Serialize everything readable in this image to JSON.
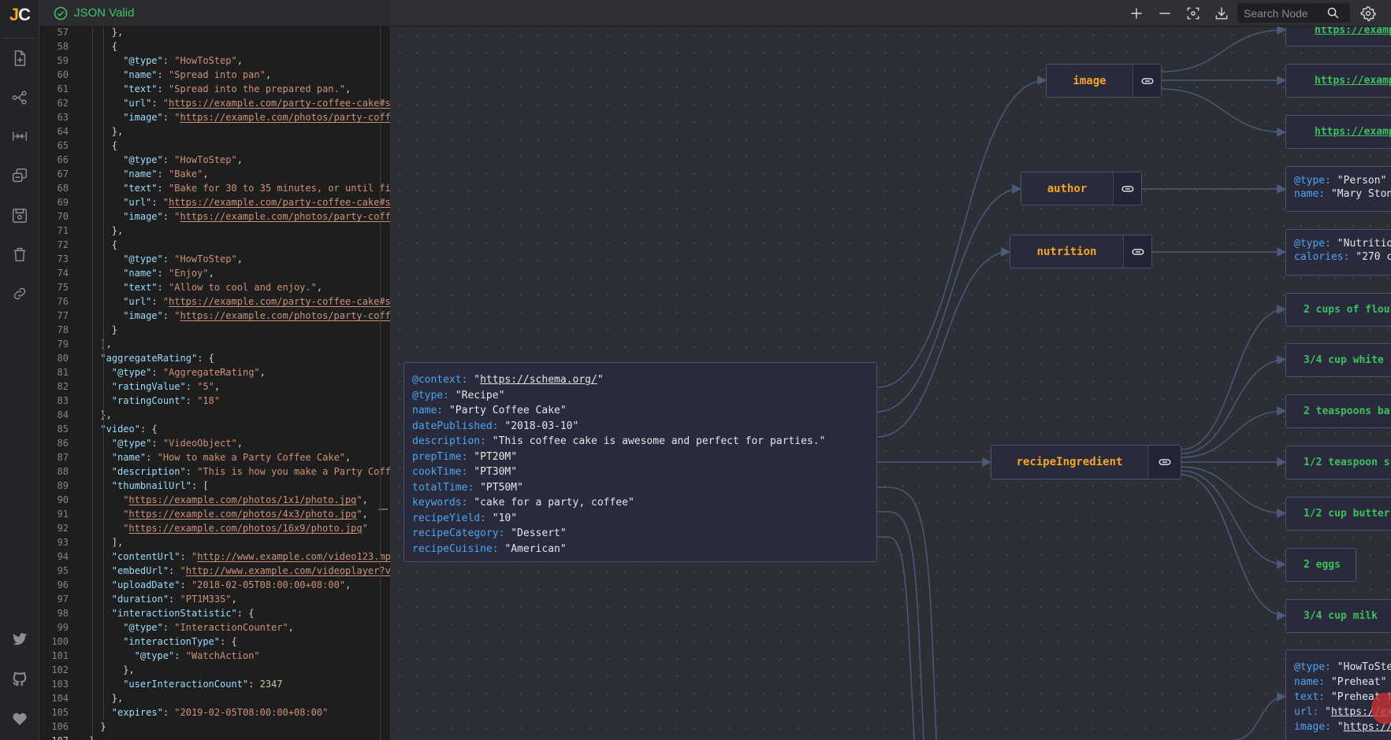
{
  "app": {
    "logo": "JC",
    "status": "JSON Valid"
  },
  "sidebar": {
    "top_icons": [
      "new-file-icon",
      "graph-icon",
      "collapse-icon",
      "duplicate-icon",
      "save-icon",
      "trash-icon",
      "link-icon"
    ],
    "bottom_icons": [
      "twitter-icon",
      "github-icon",
      "heart-icon"
    ]
  },
  "toolbar": {
    "search_placeholder": "Search Node",
    "buttons": [
      "zoom-in-icon",
      "zoom-out-icon",
      "fit-view-icon",
      "download-icon"
    ]
  },
  "editor": {
    "current_line": 107,
    "lines": [
      {
        "n": 57,
        "i": 2,
        "t": "},"
      },
      {
        "n": 58,
        "i": 2,
        "t": "{"
      },
      {
        "n": 59,
        "i": 3,
        "k": "@type",
        "v": "HowToStep",
        "vt": "s",
        "e": ","
      },
      {
        "n": 60,
        "i": 3,
        "k": "name",
        "v": "Spread into pan",
        "vt": "s",
        "e": ","
      },
      {
        "n": 61,
        "i": 3,
        "k": "text",
        "v": "Spread into the prepared pan.",
        "vt": "s",
        "e": ","
      },
      {
        "n": 62,
        "i": 3,
        "k": "url",
        "v": "https://example.com/party-coffee-cake#s",
        "vt": "u",
        "open": true
      },
      {
        "n": 63,
        "i": 3,
        "k": "image",
        "v": "https://example.com/photos/party-coff",
        "vt": "u",
        "open": true
      },
      {
        "n": 64,
        "i": 2,
        "t": "},"
      },
      {
        "n": 65,
        "i": 2,
        "t": "{"
      },
      {
        "n": 66,
        "i": 3,
        "k": "@type",
        "v": "HowToStep",
        "vt": "s",
        "e": ","
      },
      {
        "n": 67,
        "i": 3,
        "k": "name",
        "v": "Bake",
        "vt": "s",
        "e": ","
      },
      {
        "n": 68,
        "i": 3,
        "k": "text",
        "v": "Bake for 30 to 35 minutes, or until fi",
        "vt": "s",
        "open": true
      },
      {
        "n": 69,
        "i": 3,
        "k": "url",
        "v": "https://example.com/party-coffee-cake#s",
        "vt": "u",
        "open": true
      },
      {
        "n": 70,
        "i": 3,
        "k": "image",
        "v": "https://example.com/photos/party-coff",
        "vt": "u",
        "open": true
      },
      {
        "n": 71,
        "i": 2,
        "t": "},"
      },
      {
        "n": 72,
        "i": 2,
        "t": "{"
      },
      {
        "n": 73,
        "i": 3,
        "k": "@type",
        "v": "HowToStep",
        "vt": "s",
        "e": ","
      },
      {
        "n": 74,
        "i": 3,
        "k": "name",
        "v": "Enjoy",
        "vt": "s",
        "e": ","
      },
      {
        "n": 75,
        "i": 3,
        "k": "text",
        "v": "Allow to cool and enjoy.",
        "vt": "s",
        "e": ","
      },
      {
        "n": 76,
        "i": 3,
        "k": "url",
        "v": "https://example.com/party-coffee-cake#s",
        "vt": "u",
        "open": true
      },
      {
        "n": 77,
        "i": 3,
        "k": "image",
        "v": "https://example.com/photos/party-coff",
        "vt": "u",
        "open": true
      },
      {
        "n": 78,
        "i": 2,
        "t": "}"
      },
      {
        "n": 79,
        "i": 1,
        "t": "],"
      },
      {
        "n": 80,
        "i": 1,
        "k": "aggregateRating",
        "t": "{"
      },
      {
        "n": 81,
        "i": 2,
        "k": "@type",
        "v": "AggregateRating",
        "vt": "s",
        "e": ","
      },
      {
        "n": 82,
        "i": 2,
        "k": "ratingValue",
        "v": "5",
        "vt": "s",
        "e": ","
      },
      {
        "n": 83,
        "i": 2,
        "k": "ratingCount",
        "v": "18",
        "vt": "s"
      },
      {
        "n": 84,
        "i": 1,
        "t": "},"
      },
      {
        "n": 85,
        "i": 1,
        "k": "video",
        "t": "{"
      },
      {
        "n": 86,
        "i": 2,
        "k": "@type",
        "v": "VideoObject",
        "vt": "s",
        "e": ","
      },
      {
        "n": 87,
        "i": 2,
        "k": "name",
        "v": "How to make a Party Coffee Cake",
        "vt": "s",
        "e": ","
      },
      {
        "n": 88,
        "i": 2,
        "k": "description",
        "v": "This is how you make a Party Coff",
        "vt": "s",
        "open": true
      },
      {
        "n": 89,
        "i": 2,
        "k": "thumbnailUrl",
        "t": "["
      },
      {
        "n": 90,
        "i": 3,
        "v": "https://example.com/photos/1x1/photo.jpg",
        "vt": "u",
        "e": ","
      },
      {
        "n": 91,
        "i": 3,
        "v": "https://example.com/photos/4x3/photo.jpg",
        "vt": "u",
        "e": ","
      },
      {
        "n": 92,
        "i": 3,
        "v": "https://example.com/photos/16x9/photo.jpg",
        "vt": "u"
      },
      {
        "n": 93,
        "i": 2,
        "t": "],"
      },
      {
        "n": 94,
        "i": 2,
        "k": "contentUrl",
        "v": "http://www.example.com/video123.mp",
        "vt": "u",
        "open": true
      },
      {
        "n": 95,
        "i": 2,
        "k": "embedUrl",
        "v": "http://www.example.com/videoplayer?v",
        "vt": "u",
        "open": true
      },
      {
        "n": 96,
        "i": 2,
        "k": "uploadDate",
        "v": "2018-02-05T08:00:00+08:00",
        "vt": "s",
        "e": ","
      },
      {
        "n": 97,
        "i": 2,
        "k": "duration",
        "v": "PT1M33S",
        "vt": "s",
        "e": ","
      },
      {
        "n": 98,
        "i": 2,
        "k": "interactionStatistic",
        "t": "{"
      },
      {
        "n": 99,
        "i": 3,
        "k": "@type",
        "v": "InteractionCounter",
        "vt": "s",
        "e": ","
      },
      {
        "n": 100,
        "i": 3,
        "k": "interactionType",
        "t": "{"
      },
      {
        "n": 101,
        "i": 4,
        "k": "@type",
        "v": "WatchAction",
        "vt": "s"
      },
      {
        "n": 102,
        "i": 3,
        "t": "},"
      },
      {
        "n": 103,
        "i": 3,
        "k": "userInteractionCount",
        "v": "2347",
        "vt": "n"
      },
      {
        "n": 104,
        "i": 2,
        "t": "},"
      },
      {
        "n": 105,
        "i": 2,
        "k": "expires",
        "v": "2019-02-05T08:00:00+08:00",
        "vt": "s"
      },
      {
        "n": 106,
        "i": 1,
        "t": "}"
      },
      {
        "n": 107,
        "i": 0,
        "t": "}"
      }
    ]
  },
  "graph": {
    "root": [
      {
        "k": "@context",
        "v": "https://schema.org/",
        "url": true
      },
      {
        "k": "@type",
        "v": "Recipe"
      },
      {
        "k": "name",
        "v": "Party Coffee Cake"
      },
      {
        "k": "datePublished",
        "v": "2018-03-10"
      },
      {
        "k": "description",
        "v": "This coffee cake is awesome and perfect for parties."
      },
      {
        "k": "prepTime",
        "v": "PT20M"
      },
      {
        "k": "cookTime",
        "v": "PT30M"
      },
      {
        "k": "totalTime",
        "v": "PT50M"
      },
      {
        "k": "keywords",
        "v": "cake for a party, coffee"
      },
      {
        "k": "recipeYield",
        "v": "10"
      },
      {
        "k": "recipeCategory",
        "v": "Dessert"
      },
      {
        "k": "recipeCuisine",
        "v": "American"
      }
    ],
    "parents": {
      "image": "image",
      "author": "author",
      "nutrition": "nutrition",
      "recipeIngredient": "recipeIngredient"
    },
    "image_urls": [
      "https://examp",
      "https://examp",
      "https://examp"
    ],
    "author": [
      {
        "k": "@type",
        "v": "Person"
      },
      {
        "k": "name",
        "v": "Mary Ston"
      }
    ],
    "nutrition": [
      {
        "k": "@type",
        "v": "Nutritio"
      },
      {
        "k": "calories",
        "v": "270 c"
      }
    ],
    "ingredients": [
      "2 cups of flou",
      "3/4 cup white",
      "2 teaspoons ba",
      "1/2 teaspoon s",
      "1/2 cup butter",
      "2 eggs",
      "3/4 cup milk"
    ],
    "step": [
      {
        "k": "@type",
        "v": "HowToSte"
      },
      {
        "k": "name",
        "v": "Preheat"
      },
      {
        "k": "text",
        "v": "Preheat t"
      },
      {
        "k": "url",
        "v": "https://ex",
        "url": true
      },
      {
        "k": "image",
        "v": "https://",
        "url": true
      }
    ]
  },
  "colors": {
    "accent": "#f5a524",
    "valid": "#40c463",
    "key": "#4fa3ef",
    "leaf": "#3fbf5f",
    "edge": "#4a5a78"
  }
}
